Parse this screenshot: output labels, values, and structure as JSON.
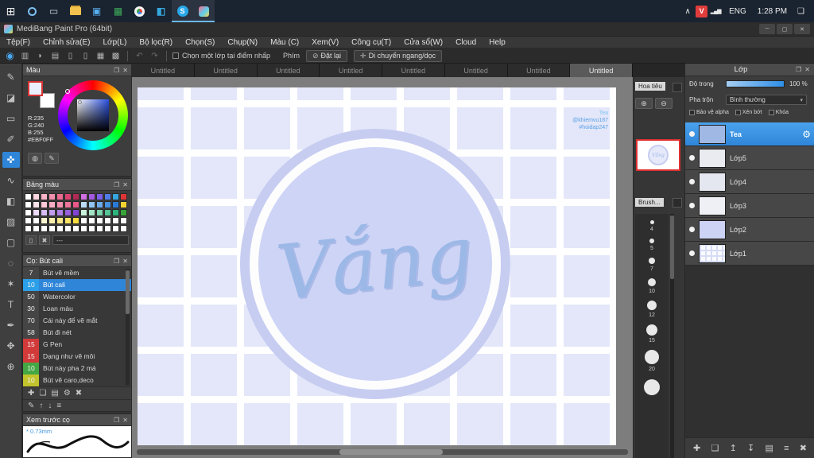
{
  "ui": {
    "popout": "❐",
    "close": "✕"
  },
  "taskbar": {
    "time": "1:28 PM",
    "language": "ENG",
    "action_glyph": "❏",
    "apps": [
      {
        "name": "start",
        "glyph": "⊞"
      },
      {
        "name": "search",
        "glyph": ""
      },
      {
        "name": "task-view",
        "glyph": "▭"
      },
      {
        "name": "file-explorer",
        "glyph": ""
      },
      {
        "name": "photos",
        "glyph": "▣"
      },
      {
        "name": "excel",
        "glyph": "▦"
      },
      {
        "name": "chrome",
        "glyph": ""
      },
      {
        "name": "vscode",
        "glyph": "◧"
      },
      {
        "name": "skype",
        "glyph": "S",
        "active": true
      },
      {
        "name": "medibang",
        "glyph": "",
        "active": true
      }
    ],
    "tray_icons": [
      {
        "name": "chevron-up",
        "glyph": "∧"
      },
      {
        "name": "vlc",
        "glyph": "V"
      },
      {
        "name": "network",
        "glyph": "▂▄▆"
      }
    ]
  },
  "window": {
    "title": "MediBang Paint Pro (64bit)",
    "minimize_glyph": "─",
    "maximize_glyph": "▢",
    "close_glyph": "✕"
  },
  "menubar": {
    "items": [
      "Tệp(F)",
      "Chỉnh sửa(E)",
      "Lớp(L)",
      "Bộ lọc(R)",
      "Chọn(S)",
      "Chụp(N)",
      "Màu (C)",
      "Xem(V)",
      "Công cụ(T)",
      "Cửa sổ(W)",
      "Cloud",
      "Help"
    ]
  },
  "toolbar": {
    "icons": [
      {
        "name": "draw-mode",
        "glyph": "◉",
        "active": true
      },
      {
        "name": "save",
        "glyph": "▥"
      },
      {
        "name": "comment",
        "glyph": "◗"
      },
      {
        "name": "material-panel",
        "glyph": "▤"
      },
      {
        "name": "doc-a",
        "glyph": "▯"
      },
      {
        "name": "doc-b",
        "glyph": "▯"
      },
      {
        "name": "grid-view",
        "glyph": "▦"
      },
      {
        "name": "table-view",
        "glyph": "▩"
      }
    ],
    "undo_glyph": "↶",
    "redo_glyph": "↷",
    "checkbox_label": "Chọn một lớp tại điểm nhấp",
    "key_label": "Phím",
    "reset_icon": "⊘",
    "reset_label": "Đặt lại",
    "move_icon": "✛",
    "move_label": "Di chuyển ngang/dọc"
  },
  "tabs": {
    "items": [
      "Untitled",
      "Untitled",
      "Untitled",
      "Untitled",
      "Untitled",
      "Untitled",
      "Untitled",
      "Untitled"
    ],
    "active_index": 7
  },
  "tools": [
    {
      "name": "pen-tool",
      "glyph": "✎"
    },
    {
      "name": "eraser-tool",
      "glyph": "◪"
    },
    {
      "name": "select-tool",
      "glyph": "▭"
    },
    {
      "name": "brush-tool",
      "glyph": "✐"
    },
    {
      "name": "move-tool",
      "glyph": "✜",
      "active": true
    },
    {
      "name": "curve-tool",
      "glyph": "∿"
    },
    {
      "name": "fill-tool",
      "glyph": "◧"
    },
    {
      "name": "gradient-tool",
      "glyph": "▨"
    },
    {
      "name": "shape-select-tool",
      "glyph": "▢"
    },
    {
      "name": "lasso-tool",
      "glyph": "◌"
    },
    {
      "name": "wand-tool",
      "glyph": "✶"
    },
    {
      "name": "text-tool",
      "glyph": "T"
    },
    {
      "name": "eyedropper-tool",
      "glyph": "✒"
    },
    {
      "name": "hand-tool",
      "glyph": "✥"
    },
    {
      "name": "zoom-tool",
      "glyph": "⊕"
    }
  ],
  "color_panel": {
    "title": "Màu",
    "r_label": "R:235",
    "g_label": "G:240",
    "b_label": "B:255",
    "hex_label": "#EBF0FF",
    "web_icon": "◍",
    "edit_icon": "✎"
  },
  "palette_panel": {
    "title": "Bảng màu",
    "footer_value": "---",
    "new_icon": "▯",
    "delete_icon": "✖",
    "colors": [
      "#ffffff",
      "#fbd5e0",
      "#f7b3c8",
      "#f28fae",
      "#ec6a92",
      "#d94372",
      "#b02a56",
      "#cf6fe0",
      "#a45ae0",
      "#7b5fe8",
      "#4f7ce8",
      "#37a6e0",
      "#df3434",
      "#ffffff",
      "#fde4ec",
      "#fbc9d8",
      "#f7aec4",
      "#f392b0",
      "#ee759c",
      "#e85888",
      "#bcdcf8",
      "#92c4f2",
      "#6caae8",
      "#4691e0",
      "#2b79d6",
      "#f2d233",
      "#ffffff",
      "#ecdcfa",
      "#d8bcf4",
      "#c29cec",
      "#ad7ee4",
      "#9760dc",
      "#8244d4",
      "#caf2da",
      "#a4e4c4",
      "#7cd4ac",
      "#54c494",
      "#2cb47c",
      "#36a438",
      "#ffffff",
      "#ffffff",
      "#fdf6d2",
      "#fcefad",
      "#fbe989",
      "#fae364",
      "#f9dd40",
      "#ffffff",
      "#ffffff",
      "#ffffff",
      "#ffffff",
      "#ffffff",
      "#ffffff",
      "#ffffff",
      "#ffffff",
      "#ffffff",
      "#ffffff",
      "#ffffff",
      "#ffffff",
      "#ffffff",
      "#ffffff",
      "#ffffff",
      "#ffffff",
      "#ffffff",
      "#ffffff",
      "#ffffff"
    ]
  },
  "brush_panel": {
    "title": "Cọ: Bút cali",
    "brushes": [
      {
        "size": "7",
        "name": "Bút vẽ mềm",
        "tag": "#454545"
      },
      {
        "size": "10",
        "name": "Bút cali",
        "tag": "#2b9fe8",
        "selected": true
      },
      {
        "size": "50",
        "name": "Watercolor",
        "tag": "#454545"
      },
      {
        "size": "30",
        "name": "Loan màu",
        "tag": "#454545"
      },
      {
        "size": "70",
        "name": "Cái này để vẽ mắt",
        "tag": "#454545"
      },
      {
        "size": "58",
        "name": "Bút đi nét",
        "tag": "#454545"
      },
      {
        "size": "15",
        "name": "G Pen",
        "tag": "#d23a3a"
      },
      {
        "size": "15",
        "name": "Dạng như vẽ môi",
        "tag": "#d23a3a"
      },
      {
        "size": "10",
        "name": "Bút này pha 2 má",
        "tag": "#43a843"
      },
      {
        "size": "10",
        "name": "Bút vẽ caro,deco",
        "tag": "#c3c32e"
      }
    ],
    "footer1": [
      {
        "name": "add-brush",
        "glyph": "✚"
      },
      {
        "name": "duplicate-brush",
        "glyph": "❏"
      },
      {
        "name": "brush-folder",
        "glyph": "▤"
      },
      {
        "name": "brush-settings",
        "glyph": "⚙"
      },
      {
        "name": "delete-brush",
        "glyph": "✖"
      }
    ],
    "footer2": [
      {
        "name": "edit-brush",
        "glyph": "✎"
      },
      {
        "name": "brush-up",
        "glyph": "↑"
      },
      {
        "name": "brush-down",
        "glyph": "↓"
      },
      {
        "name": "brush-menu",
        "glyph": "≡"
      }
    ]
  },
  "preview_panel": {
    "title": "Xem trước cọ",
    "marker": "*",
    "size_label": "0.73mm"
  },
  "canvas": {
    "word": "Vắng",
    "watermark_line1": "Tea",
    "watermark_line2": "@khiemvu187",
    "watermark_line3": "#hoidap247"
  },
  "navigator": {
    "title": "Hoa tiêu",
    "zoom_in": "⊕",
    "zoom_out": "⊖",
    "brush_label": "Brush...",
    "sizes": [
      4,
      5,
      7,
      10,
      12,
      15,
      20
    ]
  },
  "layers_panel": {
    "title": "Lớp",
    "opacity_label": "Độ trong",
    "opacity_value": "100 %",
    "blend_label": "Pha trộn",
    "blend_value": "Bình thường",
    "blend_caret": "▾",
    "alpha_label": "Bảo vệ alpha",
    "clip_label": "Xén bớt",
    "lock_label": "Khóa",
    "gear_glyph": "⚙",
    "layers": [
      {
        "name": "Tea",
        "thumb": "#9fb8e4",
        "selected": true
      },
      {
        "name": "Lớp5",
        "thumb": "#e9ebf1"
      },
      {
        "name": "Lớp4",
        "thumb": "#e4e7ef"
      },
      {
        "name": "Lớp3",
        "thumb": "#eef0f6"
      },
      {
        "name": "Lớp2",
        "thumb": "#ccd3f4"
      },
      {
        "name": "Lớp1",
        "thumb": "#fafbff",
        "grid": true
      }
    ],
    "footer_icons": [
      {
        "name": "new-layer",
        "glyph": "✚"
      },
      {
        "name": "duplicate-layer",
        "glyph": "❏"
      },
      {
        "name": "transfer-layer",
        "glyph": "↥"
      },
      {
        "name": "merge-layer",
        "glyph": "↧"
      },
      {
        "name": "layer-folder",
        "glyph": "▤"
      },
      {
        "name": "layer-menu",
        "glyph": "≡"
      },
      {
        "name": "delete-layer",
        "glyph": "✖"
      }
    ]
  }
}
